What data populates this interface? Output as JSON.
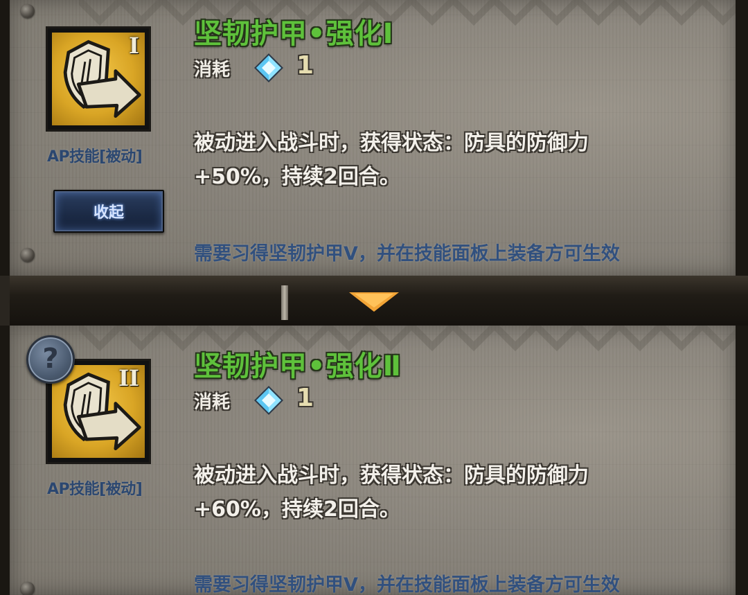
{
  "skills": [
    {
      "title": "坚韧护甲•强化Ⅰ",
      "tier_numeral": "I",
      "type_label": "AP技能[被动]",
      "cost_label": "消耗",
      "cost_value": "1",
      "description_line1": "被动进入战斗时，获得状态：防具的防御力",
      "description_line2": "+50%，持续2回合。",
      "requirement": "需要习得坚韧护甲Ⅴ，并在技能面板上装备方可生效",
      "button_label": "收起"
    },
    {
      "title": "坚韧护甲•强化Ⅱ",
      "tier_numeral": "II",
      "type_label": "AP技能[被动]",
      "cost_label": "消耗",
      "cost_value": "1",
      "description_line1": "被动进入战斗时，获得状态：防具的防御力",
      "description_line2": "+60%，持续2回合。",
      "requirement": "需要习得坚韧护甲Ⅴ，并在技能面板上装备方可生效",
      "help_badge": "?"
    }
  ],
  "icons": {
    "skill": "shield-arrow-icon",
    "cost": "diamond-gem-icon",
    "divider": "down-arrow-icon",
    "help": "question-mark-icon"
  },
  "colors": {
    "title_green": "#5ec13b",
    "requirement_blue": "#31507e",
    "icon_gold": "#d9a525",
    "arrow_orange": "#f0a030"
  }
}
